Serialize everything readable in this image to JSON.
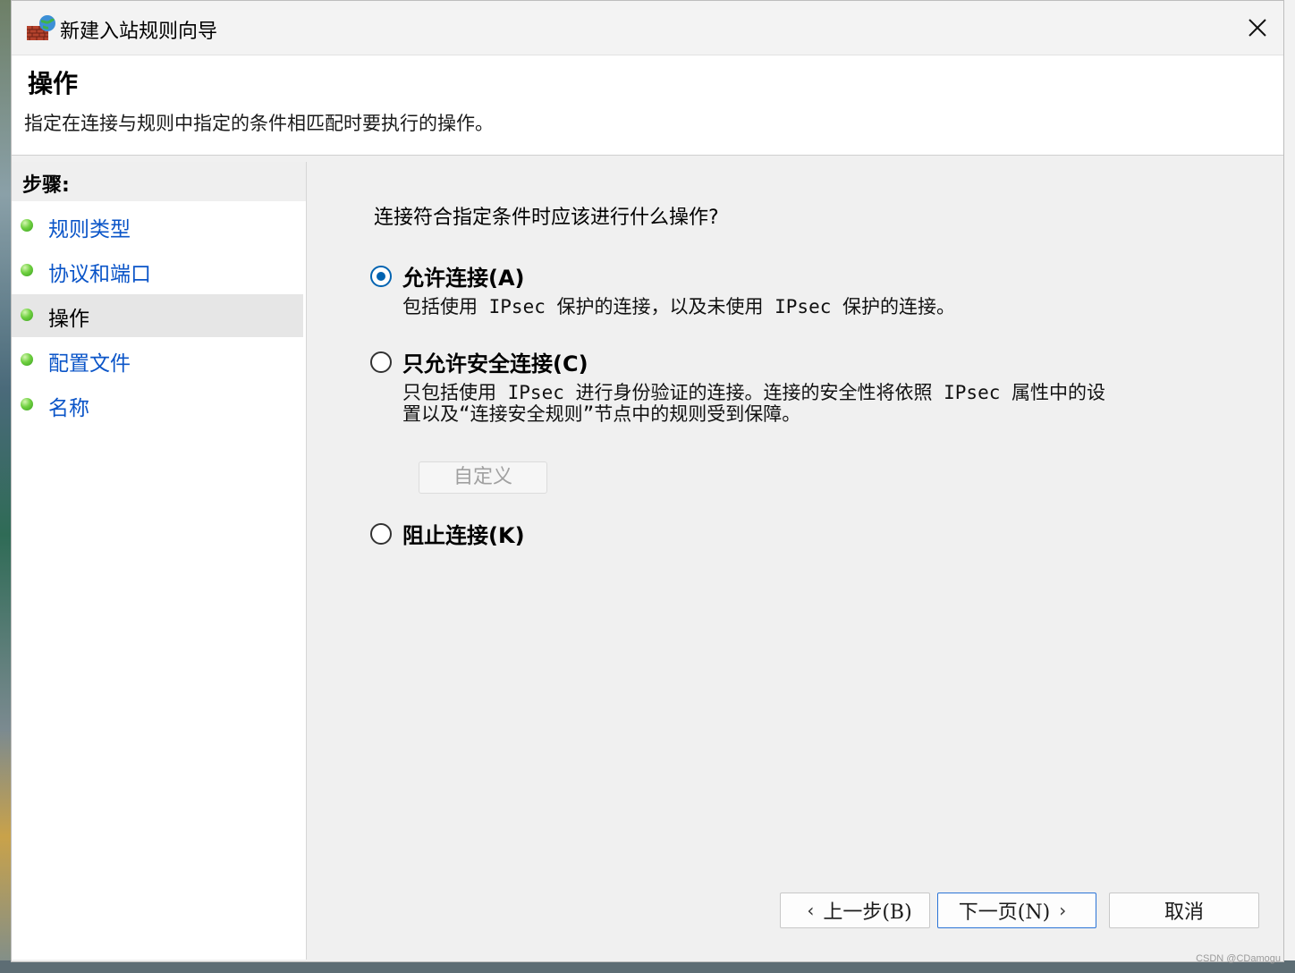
{
  "window": {
    "title": "新建入站规则向导",
    "close_symbol": "✕"
  },
  "header": {
    "title": "操作",
    "description": "指定在连接与规则中指定的条件相匹配时要执行的操作。"
  },
  "steps": {
    "heading": "步骤:",
    "items": [
      {
        "label": "规则类型",
        "active": false
      },
      {
        "label": "协议和端口",
        "active": false
      },
      {
        "label": "操作",
        "active": true
      },
      {
        "label": "配置文件",
        "active": false
      },
      {
        "label": "名称",
        "active": false
      }
    ]
  },
  "main": {
    "question": "连接符合指定条件时应该进行什么操作?",
    "options": [
      {
        "label": "允许连接(A)",
        "selected": true,
        "description": [
          "包括使用 IPsec 保护的连接，以及未使用 IPsec 保护的连接。"
        ]
      },
      {
        "label": "只允许安全连接(C)",
        "selected": false,
        "description": [
          "只包括使用 IPsec 进行身份验证的连接。连接的安全性将依照 IPsec 属性中的设",
          "置以及“连接安全规则”节点中的规则受到保障。"
        ]
      },
      {
        "label": "阻止连接(K)",
        "selected": false,
        "description": []
      }
    ],
    "customize_label": "自定义"
  },
  "footer": {
    "back_label": "上一步(B)",
    "next_label": "下一页(N)",
    "cancel_label": "取消"
  },
  "watermark": "CSDN @CDamogu",
  "colors": {
    "link": "#0b55c8",
    "accent": "#0063b1",
    "bullet": "#6fd040"
  }
}
